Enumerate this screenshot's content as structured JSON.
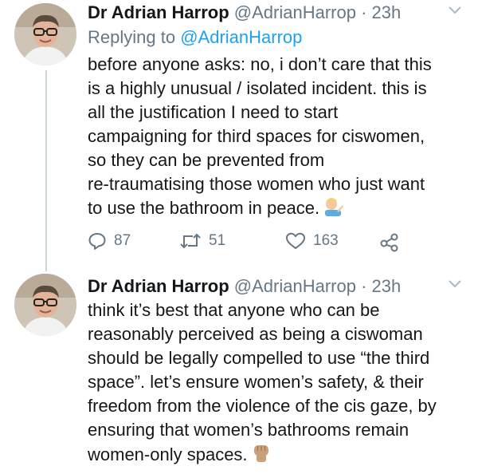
{
  "tweets": [
    {
      "name": "Dr Adrian Harrop",
      "handle": "@AdrianHarrop",
      "separator": "·",
      "time": "23h",
      "replying_label": "Replying to",
      "replying_handle": "@AdrianHarrop",
      "lines": [
        "before anyone asks: no, i don’t care that this",
        "is a highly unusual / isolated incident. this is",
        "all the justification I need to start",
        "campaigning for third spaces for ciswomen,",
        "so they can be prevented from",
        "re-traumatising those women who just want",
        "to use the bathroom in peace."
      ],
      "end_emoji": "man-tipping-hand-icon",
      "actions": {
        "replies": "87",
        "retweets": "51",
        "likes": "163"
      }
    },
    {
      "name": "Dr Adrian Harrop",
      "handle": "@AdrianHarrop",
      "separator": "·",
      "time": "23h",
      "lines": [
        "think it’s best that anyone who can be",
        "reasonably perceived as being a ciswoman",
        "should be legally compelled to use “the third",
        "space”. let’s ensure women’s safety, & their",
        "freedom from the violence of the cis gaze, by",
        "ensuring that women’s bathrooms remain",
        "women-only spaces."
      ],
      "end_emoji": "raised-fist-icon"
    }
  ],
  "colors": {
    "text": "#14171a",
    "secondary": "#657786",
    "link": "#1da1f2",
    "thread_line": "#ccd6dd"
  }
}
